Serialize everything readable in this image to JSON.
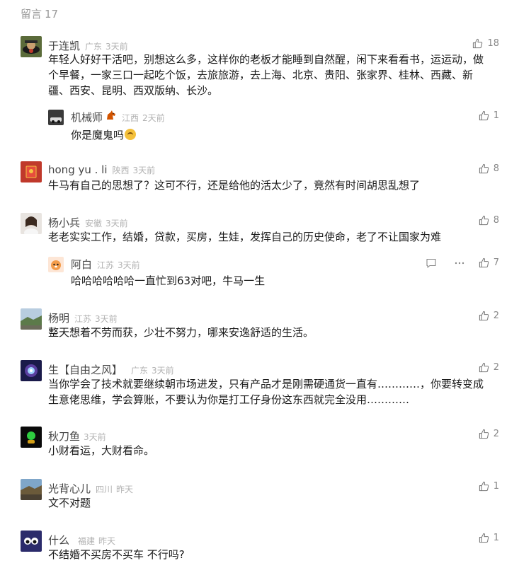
{
  "header": {
    "title": "留言",
    "count": "17"
  },
  "comments": [
    {
      "name": "于连凯",
      "location": "广东",
      "time": "3天前",
      "likes": "18",
      "text": "年轻人好好干活吧，别想这么多，这样你的老板才能睡到自然醒，闲下来看看书，运运动，做个早餐，一家三口一起吃个饭，去旅旅游，去上海、北京、贵阳、张家界、桂林、西藏、新疆、西安、昆明、西双版纳、长沙。",
      "reply": {
        "name": "机械师",
        "location": "江西",
        "time": "2天前",
        "likes": "1",
        "text": "你是魔鬼吗"
      }
    },
    {
      "name": "hong yu . li",
      "location": "陕西",
      "time": "3天前",
      "likes": "8",
      "text": "牛马有自己的思想了？这可不行，还是给他的活太少了，竟然有时间胡思乱想了"
    },
    {
      "name": "杨小兵",
      "location": "安徽",
      "time": "3天前",
      "likes": "8",
      "text": "老老实实工作，结婚，贷款，买房，生娃，发挥自己的历史使命，老了不让国家为难",
      "reply": {
        "name": "阿白",
        "location": "江苏",
        "time": "3天前",
        "likes": "7",
        "text": "哈哈哈哈哈哈一直忙到63对吧，牛马一生"
      }
    },
    {
      "name": "杨明",
      "location": "江苏",
      "time": "3天前",
      "likes": "2",
      "text": "整天想着不劳而获，少壮不努力，哪来安逸舒适的生活。"
    },
    {
      "name": "生【自由之风】",
      "location": "广东",
      "time": "3天前",
      "likes": "2",
      "text": "当你学会了技术就要继续朝市场进发，只有产品才是刚需硬通货一直有…………，你要转变成生意佬思维，学会算账，不要认为你是打工仔身份这东西就完全没用…………"
    },
    {
      "name": "秋刀鱼",
      "location": "",
      "time": "3天前",
      "likes": "2",
      "text": "小财看运，大财看命。"
    },
    {
      "name": "光背心儿",
      "location": "四川",
      "time": "昨天",
      "likes": "1",
      "text": "文不对题"
    },
    {
      "name": "什么",
      "location": "福建",
      "time": "昨天",
      "likes": "1",
      "text": "不结婚不买房不买车 不行吗?"
    }
  ],
  "colors": {
    "text": "#1a1a1a",
    "meta": "#b2b2b2",
    "name": "#444444",
    "like": "#888888"
  },
  "icons": {
    "like": "thumbs-up-icon",
    "reply": "comment-icon",
    "more": "more-icon"
  }
}
